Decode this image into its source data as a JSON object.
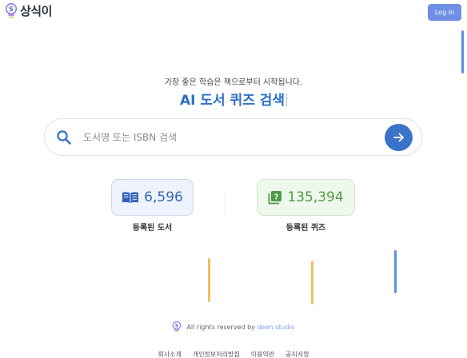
{
  "header": {
    "logo_text": "상식이",
    "login_label": "Log In"
  },
  "hero": {
    "tagline": "가장 좋은 학습은 책으로부터 시작됩니다.",
    "headline": "AI 도서 퀴즈 검색"
  },
  "search": {
    "placeholder": "도서명 또는 ISBN 검색",
    "value": ""
  },
  "stats": {
    "books": {
      "count": "6,596",
      "label": "등록된 도서"
    },
    "quizzes": {
      "count": "135,394",
      "label": "등록된 퀴즈"
    }
  },
  "footer": {
    "rights_text": "All rights reserved by",
    "studio_link": "dean studio",
    "links": [
      "회사소개",
      "개인정보처리방침",
      "이용약관",
      "공지사항"
    ]
  },
  "colors": {
    "accent": "#3a74c9",
    "login": "#6f8fe6",
    "books_text": "#3566b8",
    "quiz_text": "#4f9a46",
    "deco_yellow": "#f2c15b",
    "deco_blue": "#5c92e3"
  },
  "icons": {
    "logo": "lightbulb-s-icon",
    "search": "search-icon",
    "submit": "arrow-right-icon",
    "books": "book-open-icon",
    "quiz": "question-book-icon"
  }
}
